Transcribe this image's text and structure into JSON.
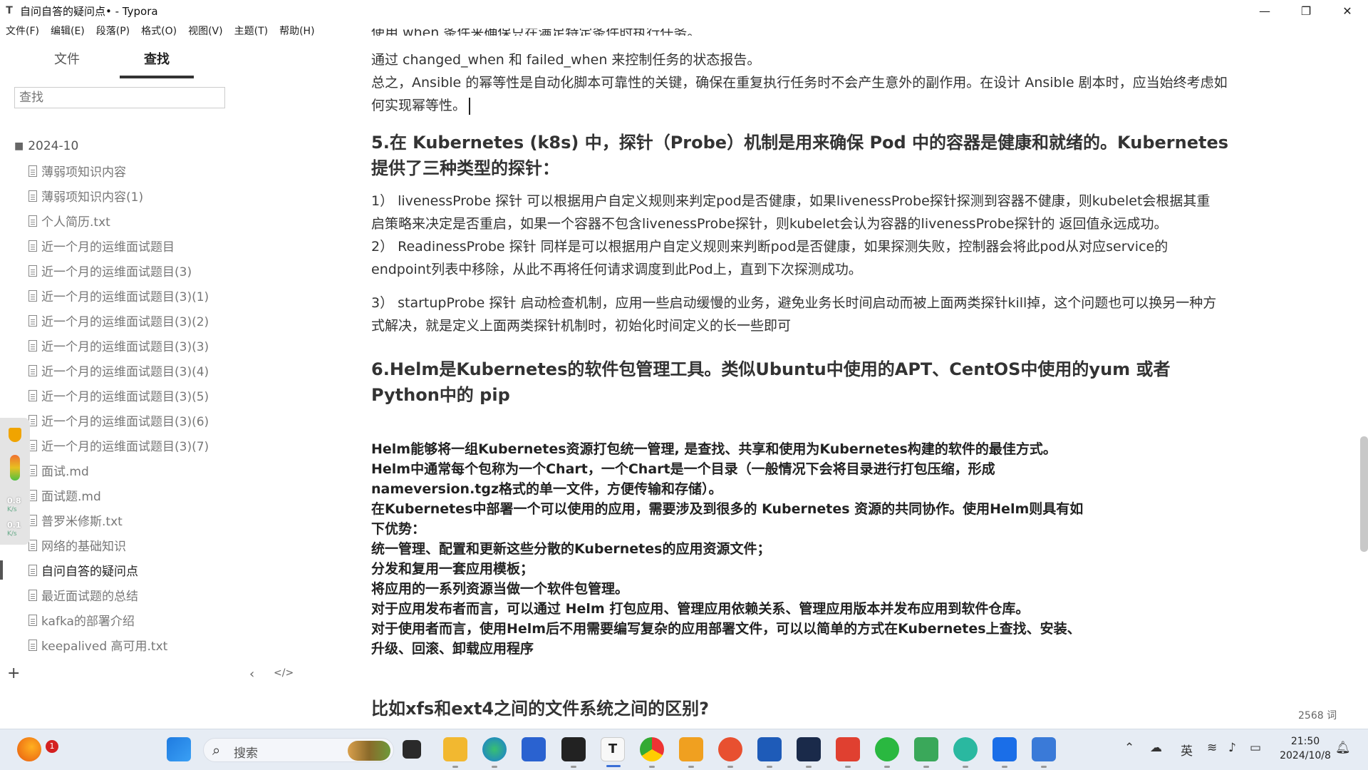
{
  "window": {
    "app_icon": "T",
    "title": "自问自答的疑问点• - Typora",
    "controls": [
      "—",
      "❐",
      "✕"
    ]
  },
  "menu": [
    "文件(F)",
    "编辑(E)",
    "段落(P)",
    "格式(O)",
    "视图(V)",
    "主题(T)",
    "帮助(H)"
  ],
  "sidebar": {
    "tabs": [
      "文件",
      "查找"
    ],
    "search_placeholder": "查找",
    "folder": "2024-10",
    "files": [
      "薄弱项知识内容",
      "薄弱项知识内容(1)",
      "个人简历.txt",
      "近一个月的运维面试题目",
      "近一个月的运维面试题目(3)",
      "近一个月的运维面试题目(3)(1)",
      "近一个月的运维面试题目(3)(2)",
      "近一个月的运维面试题目(3)(3)",
      "近一个月的运维面试题目(3)(4)",
      "近一个月的运维面试题目(3)(5)",
      "近一个月的运维面试题目(3)(6)",
      "近一个月的运维面试题目(3)(7)",
      "面试.md",
      "面试题.md",
      "普罗米修斯.txt",
      "网络的基础知识",
      "自问自答的疑问点",
      "最近面试题的总结",
      "kafka的部署介绍",
      "keepalived 高可用.txt"
    ],
    "active_file_index": 16,
    "add_label": "+",
    "collapse_label": "‹",
    "source_label": "</>"
  },
  "widget": {
    "upload": "0.8",
    "upload_unit": "K/s",
    "download": "0.1",
    "download_unit": "K/s"
  },
  "editor": {
    "cut_line": "使用 when 条件来确保只在满足特定条件时执行任务。",
    "p1": "通过 changed_when 和 failed_when 来控制任务的状态报告。",
    "p2": "总之，Ansible 的幂等性是自动化脚本可靠性的关键，确保在重复执行任务时不会产生意外的副作用。在设计 Ansible 剧本时，应当始终考虑如何实现幂等性。",
    "h5": "5.在 Kubernetes (k8s) 中，探针（Probe）机制是用来确保 Pod 中的容器是健康和就绪的。Kubernetes 提供了三种类型的探针：",
    "probe1": "1） livenessProbe 探针 可以根据用户自定义规则来判定pod是否健康，如果livenessProbe探针探测到容器不健康，则kubelet会根据其重 启策略来决定是否重启，如果一个容器不包含livenessProbe探针，则kubelet会认为容器的livenessProbe探针的 返回值永远成功。",
    "probe2": "2） ReadinessProbe 探针 同样是可以根据用户自定义规则来判断pod是否健康，如果探测失败，控制器会将此pod从对应service的endpoint列表中移除，从此不再将任何请求调度到此Pod上，直到下次探测成功。",
    "probe3": " 3） startupProbe 探针 启动检查机制，应用一些启动缓慢的业务，避免业务长时间启动而被上面两类探针kill掉，这个问题也可以换另一种方式解决，就是定义上面两类探针机制时，初始化时间定义的长一些即可",
    "h6": "6.Helm是Kubernetes的软件包管理工具。类似Ubuntu中使用的APT、CentOS中使用的yum 或者Python中的 pip",
    "helm_lines": [
      "Helm能够将一组Kubernetes资源打包统一管理, 是查找、共享和使用为Kubernetes构建的软件的最佳方式。",
      "Helm中通常每个包称为一个Chart，一个Chart是一个目录（一般情况下会将目录进行打包压缩，形成nameversion.tgz格式的单一文件，方便传输和存储）。",
      "在Kubernetes中部署一个可以使用的应用，需要涉及到很多的 Kubernetes 资源的共同协作。使用Helm则具有如下优势：",
      "统一管理、配置和更新这些分散的Kubernetes的应用资源文件；",
      "分发和复用一套应用模板；",
      "将应用的一系列资源当做一个软件包管理。",
      "对于应用发布者而言，可以通过 Helm 打包应用、管理应用依赖关系、管理应用版本并发布应用到软件仓库。",
      "对于使用者而言，使用Helm后不用需要编写复杂的应用部署文件，可以以简单的方式在Kubernetes上查找、安装、升级、回滚、卸载应用程序"
    ],
    "h7": "比如xfs和ext4之间的文件系统之间的区别?",
    "word_count": "2568 词"
  },
  "taskbar": {
    "search_placeholder": "搜索",
    "notification_badge": "1",
    "ime": "英",
    "time": "21:50",
    "date": "2024/10/8"
  }
}
